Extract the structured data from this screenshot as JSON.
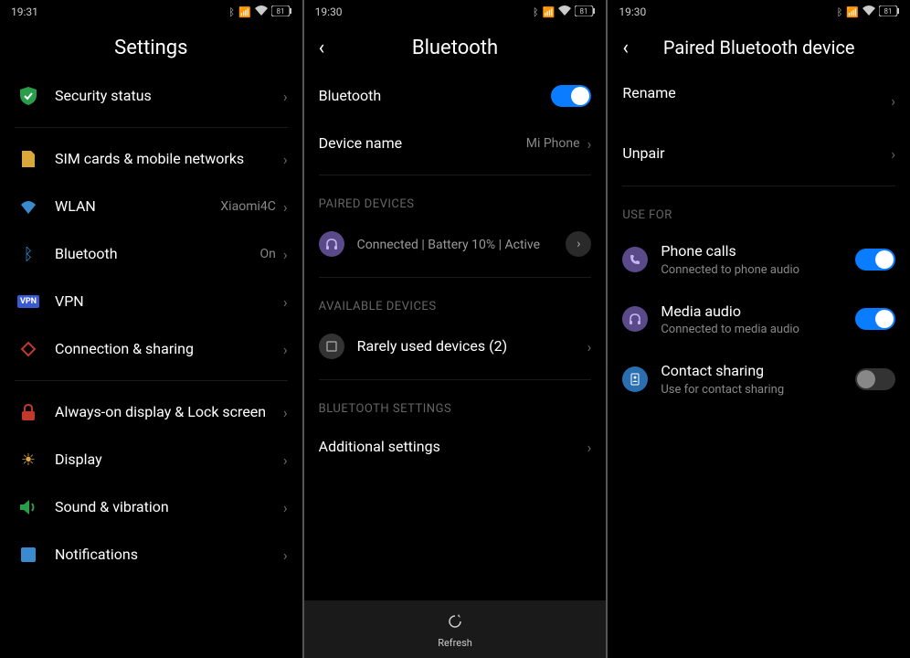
{
  "screen1": {
    "time": "19:31",
    "battery": "81",
    "title": "Settings",
    "items": [
      {
        "label": "Security status",
        "icon": "shield"
      },
      {
        "label": "SIM cards & mobile networks",
        "icon": "sim"
      },
      {
        "label": "WLAN",
        "value": "Xiaomi4C",
        "icon": "wifi"
      },
      {
        "label": "Bluetooth",
        "value": "On",
        "icon": "bt"
      },
      {
        "label": "VPN",
        "icon": "vpn"
      },
      {
        "label": "Connection & sharing",
        "icon": "share"
      },
      {
        "label": "Always-on display & Lock screen",
        "icon": "lock"
      },
      {
        "label": "Display",
        "icon": "sun"
      },
      {
        "label": "Sound & vibration",
        "icon": "sound"
      },
      {
        "label": "Notifications",
        "icon": "notif"
      }
    ]
  },
  "screen2": {
    "time": "19:30",
    "battery": "81",
    "title": "Bluetooth",
    "bluetooth_label": "Bluetooth",
    "bluetooth_on": true,
    "device_name_label": "Device name",
    "device_name_value": "Mi Phone",
    "paired_section": "PAIRED DEVICES",
    "paired_status": "Connected | Battery 10% | Active",
    "available_section": "AVAILABLE DEVICES",
    "rarely_used": "Rarely used devices (2)",
    "settings_section": "BLUETOOTH SETTINGS",
    "additional": "Additional settings",
    "refresh": "Refresh"
  },
  "screen3": {
    "time": "19:30",
    "battery": "81",
    "title": "Paired Bluetooth device",
    "rename": "Rename",
    "unpair": "Unpair",
    "use_for": "USE FOR",
    "phone_calls_label": "Phone calls",
    "phone_calls_sub": "Connected to phone audio",
    "phone_calls_on": true,
    "media_label": "Media audio",
    "media_sub": "Connected to media audio",
    "media_on": true,
    "contact_label": "Contact sharing",
    "contact_sub": "Use for contact sharing",
    "contact_on": false
  }
}
